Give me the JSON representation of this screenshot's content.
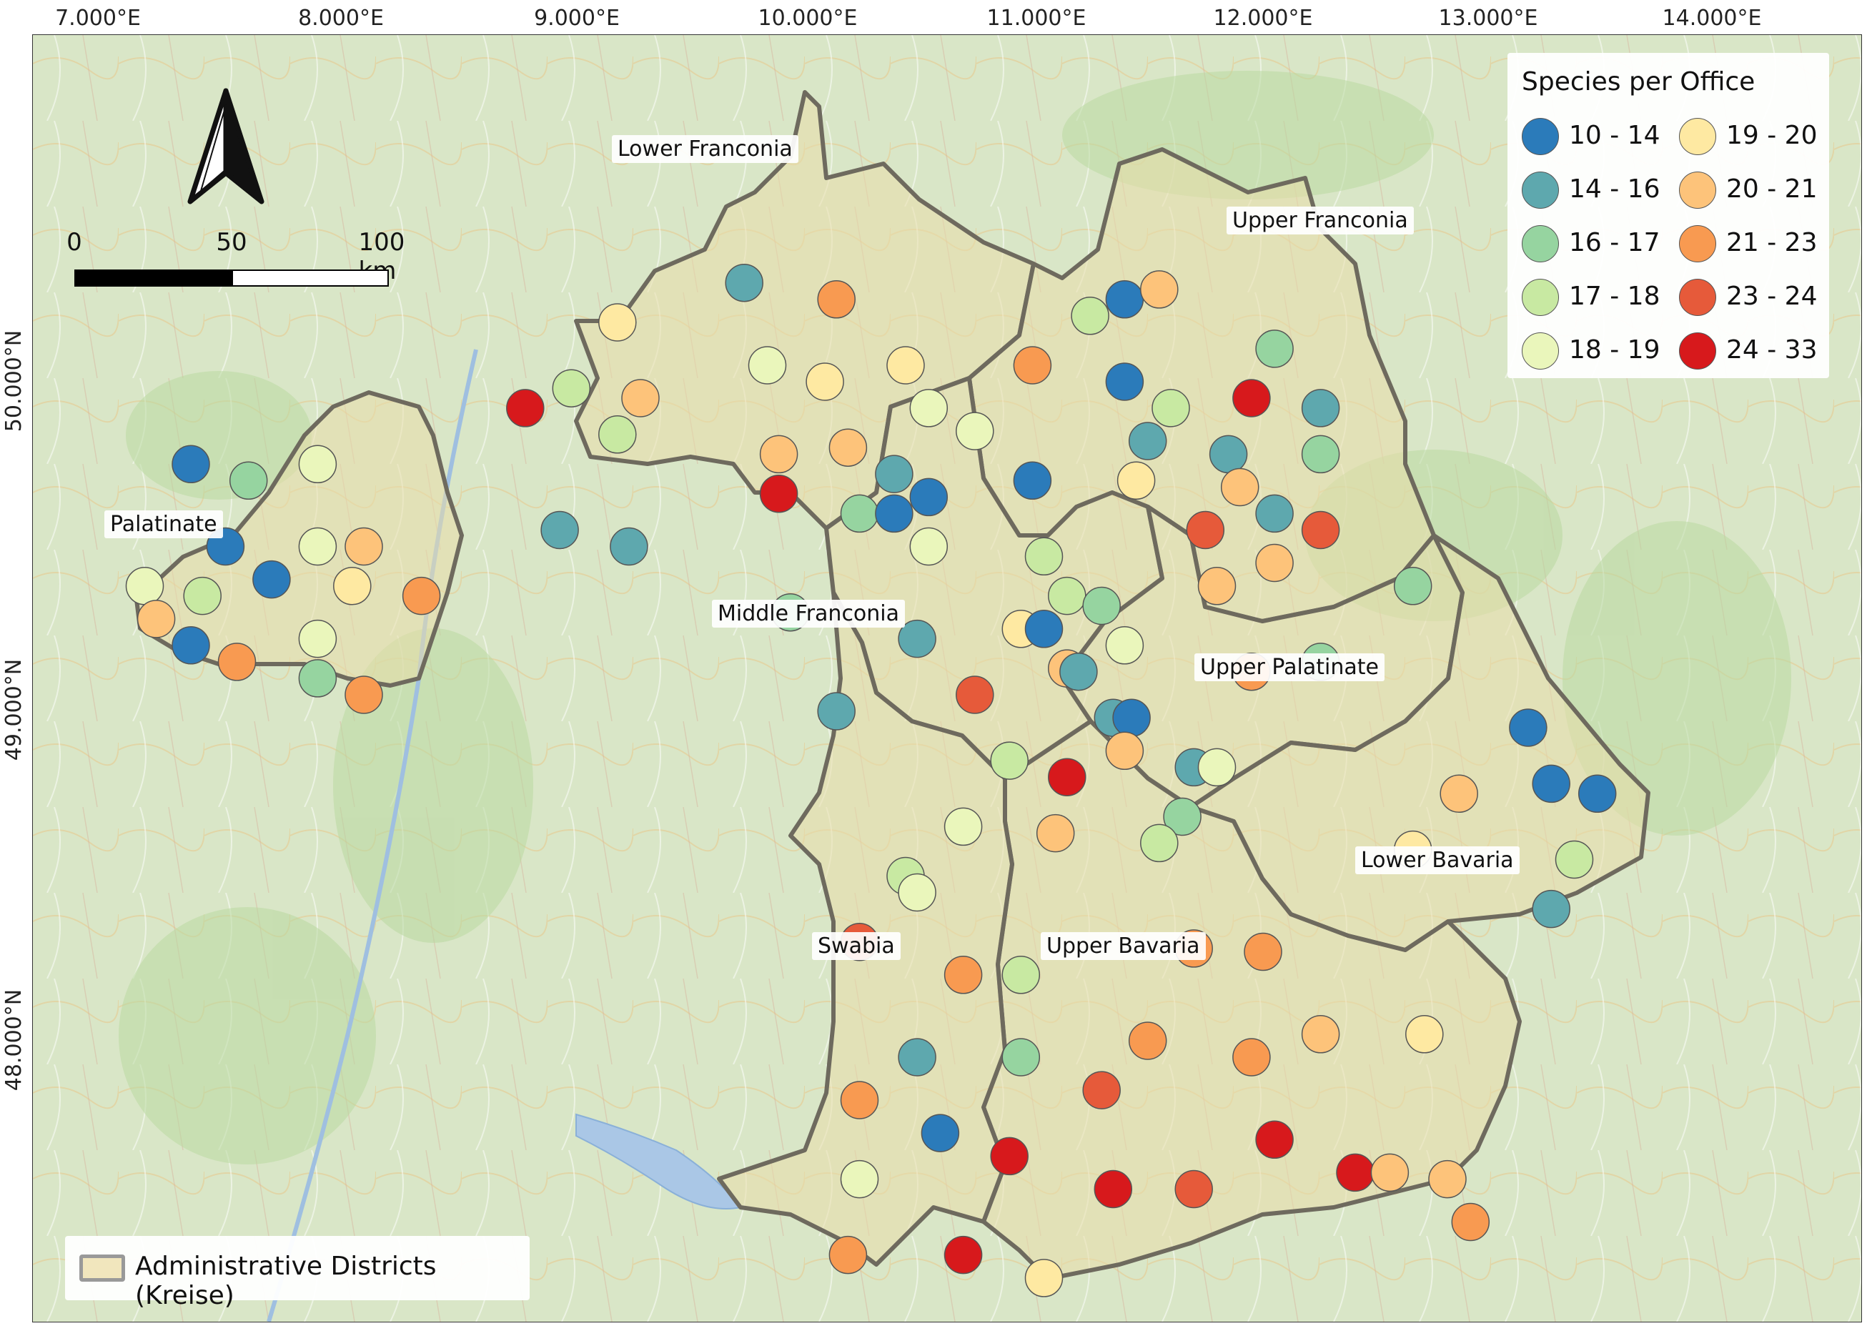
{
  "axes": {
    "longitude_labels": [
      "7.000°E",
      "8.000°E",
      "9.000°E",
      "10.000°E",
      "11.000°E",
      "12.000°E",
      "13.000°E",
      "14.000°E"
    ],
    "latitude_labels": [
      "50.000°N",
      "49.000°N",
      "48.000°N"
    ]
  },
  "regions": [
    {
      "name": "Lower Franconia"
    },
    {
      "name": "Upper Franconia"
    },
    {
      "name": "Palatinate"
    },
    {
      "name": "Middle Franconia"
    },
    {
      "name": "Upper Palatinate"
    },
    {
      "name": "Lower Bavaria"
    },
    {
      "name": "Swabia"
    },
    {
      "name": "Upper Bavaria"
    }
  ],
  "legend": {
    "title": "Species per Office",
    "classes": [
      {
        "label": "10 - 14",
        "color": "#2b7bba"
      },
      {
        "label": "14 - 16",
        "color": "#5ea8ae"
      },
      {
        "label": "16 - 17",
        "color": "#96d4a0"
      },
      {
        "label": "17 - 18",
        "color": "#c8e9a2"
      },
      {
        "label": "18 - 19",
        "color": "#eaf6bb"
      },
      {
        "label": "19 - 20",
        "color": "#fee9a2"
      },
      {
        "label": "20 - 21",
        "color": "#fdc37a"
      },
      {
        "label": "21 - 23",
        "color": "#f89a51"
      },
      {
        "label": "23 - 24",
        "color": "#e65a3a"
      },
      {
        "label": "24 - 33",
        "color": "#d7191c"
      }
    ]
  },
  "districts_legend": {
    "label": "Administrative Districts (Kreise)"
  },
  "scalebar": {
    "labels": [
      "0",
      "50",
      "100 km"
    ]
  },
  "offices": [
    {
      "lon": 9.8,
      "lat": 50.3,
      "cls": 1
    },
    {
      "lon": 10.2,
      "lat": 50.25,
      "cls": 7
    },
    {
      "lon": 9.25,
      "lat": 50.18,
      "cls": 5
    },
    {
      "lon": 9.9,
      "lat": 50.05,
      "cls": 4
    },
    {
      "lon": 10.5,
      "lat": 50.05,
      "cls": 5
    },
    {
      "lon": 10.15,
      "lat": 50.0,
      "cls": 5
    },
    {
      "lon": 9.05,
      "lat": 49.98,
      "cls": 3
    },
    {
      "lon": 9.35,
      "lat": 49.95,
      "cls": 6
    },
    {
      "lon": 8.85,
      "lat": 49.92,
      "cls": 9
    },
    {
      "lon": 10.6,
      "lat": 49.92,
      "cls": 4
    },
    {
      "lon": 9.25,
      "lat": 49.84,
      "cls": 3
    },
    {
      "lon": 10.25,
      "lat": 49.8,
      "cls": 6
    },
    {
      "lon": 10.8,
      "lat": 49.85,
      "cls": 4
    },
    {
      "lon": 9.95,
      "lat": 49.78,
      "cls": 6
    },
    {
      "lon": 10.45,
      "lat": 49.72,
      "cls": 1
    },
    {
      "lon": 9.95,
      "lat": 49.66,
      "cls": 9
    },
    {
      "lon": 10.6,
      "lat": 49.65,
      "cls": 0
    },
    {
      "lon": 10.3,
      "lat": 49.6,
      "cls": 2
    },
    {
      "lon": 10.45,
      "lat": 49.6,
      "cls": 0
    },
    {
      "lon": 9.0,
      "lat": 49.55,
      "cls": 1
    },
    {
      "lon": 10.6,
      "lat": 49.5,
      "cls": 4
    },
    {
      "lon": 11.45,
      "lat": 50.25,
      "cls": 0
    },
    {
      "lon": 11.6,
      "lat": 50.28,
      "cls": 6
    },
    {
      "lon": 11.3,
      "lat": 50.2,
      "cls": 3
    },
    {
      "lon": 12.1,
      "lat": 50.1,
      "cls": 2
    },
    {
      "lon": 11.05,
      "lat": 50.05,
      "cls": 7
    },
    {
      "lon": 11.45,
      "lat": 50.0,
      "cls": 0
    },
    {
      "lon": 12.0,
      "lat": 49.95,
      "cls": 9
    },
    {
      "lon": 11.65,
      "lat": 49.92,
      "cls": 3
    },
    {
      "lon": 12.3,
      "lat": 49.92,
      "cls": 1
    },
    {
      "lon": 11.55,
      "lat": 49.82,
      "cls": 1
    },
    {
      "lon": 11.9,
      "lat": 49.78,
      "cls": 1
    },
    {
      "lon": 12.3,
      "lat": 49.78,
      "cls": 2
    },
    {
      "lon": 11.05,
      "lat": 49.7,
      "cls": 0
    },
    {
      "lon": 11.5,
      "lat": 49.7,
      "cls": 5
    },
    {
      "lon": 11.95,
      "lat": 49.68,
      "cls": 6
    },
    {
      "lon": 12.1,
      "lat": 49.6,
      "cls": 1
    },
    {
      "lon": 11.8,
      "lat": 49.55,
      "cls": 8
    },
    {
      "lon": 12.3,
      "lat": 49.55,
      "cls": 8
    },
    {
      "lon": 11.1,
      "lat": 49.47,
      "cls": 3
    },
    {
      "lon": 12.1,
      "lat": 49.45,
      "cls": 6
    },
    {
      "lon": 11.85,
      "lat": 49.38,
      "cls": 6
    },
    {
      "lon": 12.7,
      "lat": 49.38,
      "cls": 2
    },
    {
      "lon": 9.3,
      "lat": 49.5,
      "cls": 1
    },
    {
      "lon": 11.2,
      "lat": 49.35,
      "cls": 3
    },
    {
      "lon": 11.35,
      "lat": 49.32,
      "cls": 2
    },
    {
      "lon": 10.0,
      "lat": 49.3,
      "cls": 2
    },
    {
      "lon": 11.0,
      "lat": 49.25,
      "cls": 5
    },
    {
      "lon": 11.1,
      "lat": 49.25,
      "cls": 0
    },
    {
      "lon": 10.55,
      "lat": 49.22,
      "cls": 1
    },
    {
      "lon": 11.45,
      "lat": 49.2,
      "cls": 4
    },
    {
      "lon": 12.3,
      "lat": 49.15,
      "cls": 2
    },
    {
      "lon": 11.2,
      "lat": 49.13,
      "cls": 6
    },
    {
      "lon": 11.25,
      "lat": 49.12,
      "cls": 1
    },
    {
      "lon": 12.0,
      "lat": 49.12,
      "cls": 7
    },
    {
      "lon": 10.8,
      "lat": 49.05,
      "cls": 8
    },
    {
      "lon": 10.2,
      "lat": 49.0,
      "cls": 1
    },
    {
      "lon": 11.4,
      "lat": 48.98,
      "cls": 1
    },
    {
      "lon": 11.48,
      "lat": 48.98,
      "cls": 0
    },
    {
      "lon": 13.2,
      "lat": 48.95,
      "cls": 0
    },
    {
      "lon": 10.95,
      "lat": 48.85,
      "cls": 3
    },
    {
      "lon": 11.45,
      "lat": 48.88,
      "cls": 6
    },
    {
      "lon": 11.75,
      "lat": 48.83,
      "cls": 1
    },
    {
      "lon": 11.85,
      "lat": 48.83,
      "cls": 4
    },
    {
      "lon": 11.2,
      "lat": 48.8,
      "cls": 9
    },
    {
      "lon": 13.3,
      "lat": 48.78,
      "cls": 0
    },
    {
      "lon": 13.5,
      "lat": 48.75,
      "cls": 0
    },
    {
      "lon": 12.9,
      "lat": 48.75,
      "cls": 6
    },
    {
      "lon": 11.7,
      "lat": 48.68,
      "cls": 2
    },
    {
      "lon": 10.75,
      "lat": 48.65,
      "cls": 4
    },
    {
      "lon": 11.15,
      "lat": 48.63,
      "cls": 6
    },
    {
      "lon": 11.6,
      "lat": 48.6,
      "cls": 3
    },
    {
      "lon": 12.7,
      "lat": 48.58,
      "cls": 5
    },
    {
      "lon": 13.4,
      "lat": 48.55,
      "cls": 3
    },
    {
      "lon": 10.5,
      "lat": 48.5,
      "cls": 3
    },
    {
      "lon": 10.55,
      "lat": 48.45,
      "cls": 4
    },
    {
      "lon": 13.3,
      "lat": 48.4,
      "cls": 1
    },
    {
      "lon": 10.3,
      "lat": 48.3,
      "cls": 8
    },
    {
      "lon": 11.75,
      "lat": 48.28,
      "cls": 7
    },
    {
      "lon": 12.05,
      "lat": 48.27,
      "cls": 7
    },
    {
      "lon": 10.75,
      "lat": 48.2,
      "cls": 7
    },
    {
      "lon": 11.0,
      "lat": 48.2,
      "cls": 3
    },
    {
      "lon": 12.3,
      "lat": 48.02,
      "cls": 6
    },
    {
      "lon": 12.75,
      "lat": 48.02,
      "cls": 5
    },
    {
      "lon": 11.55,
      "lat": 48.0,
      "cls": 7
    },
    {
      "lon": 12.0,
      "lat": 47.95,
      "cls": 7
    },
    {
      "lon": 10.55,
      "lat": 47.95,
      "cls": 1
    },
    {
      "lon": 11.0,
      "lat": 47.95,
      "cls": 2
    },
    {
      "lon": 11.35,
      "lat": 47.85,
      "cls": 8
    },
    {
      "lon": 10.3,
      "lat": 47.82,
      "cls": 7
    },
    {
      "lon": 10.65,
      "lat": 47.72,
      "cls": 0
    },
    {
      "lon": 12.1,
      "lat": 47.7,
      "cls": 9
    },
    {
      "lon": 10.95,
      "lat": 47.65,
      "cls": 9
    },
    {
      "lon": 12.45,
      "lat": 47.6,
      "cls": 9
    },
    {
      "lon": 12.6,
      "lat": 47.6,
      "cls": 6
    },
    {
      "lon": 12.85,
      "lat": 47.58,
      "cls": 6
    },
    {
      "lon": 10.3,
      "lat": 47.58,
      "cls": 4
    },
    {
      "lon": 11.4,
      "lat": 47.55,
      "cls": 9
    },
    {
      "lon": 11.75,
      "lat": 47.55,
      "cls": 8
    },
    {
      "lon": 12.95,
      "lat": 47.45,
      "cls": 7
    },
    {
      "lon": 10.25,
      "lat": 47.35,
      "cls": 7
    },
    {
      "lon": 10.75,
      "lat": 47.35,
      "cls": 9
    },
    {
      "lon": 11.1,
      "lat": 47.28,
      "cls": 5
    },
    {
      "lon": 7.4,
      "lat": 49.75,
      "cls": 0
    },
    {
      "lon": 7.65,
      "lat": 49.7,
      "cls": 2
    },
    {
      "lon": 7.95,
      "lat": 49.75,
      "cls": 4
    },
    {
      "lon": 7.55,
      "lat": 49.5,
      "cls": 0
    },
    {
      "lon": 7.75,
      "lat": 49.4,
      "cls": 0
    },
    {
      "lon": 7.95,
      "lat": 49.5,
      "cls": 4
    },
    {
      "lon": 8.15,
      "lat": 49.5,
      "cls": 6
    },
    {
      "lon": 7.2,
      "lat": 49.38,
      "cls": 4
    },
    {
      "lon": 7.45,
      "lat": 49.35,
      "cls": 3
    },
    {
      "lon": 8.1,
      "lat": 49.38,
      "cls": 5
    },
    {
      "lon": 8.4,
      "lat": 49.35,
      "cls": 7
    },
    {
      "lon": 7.25,
      "lat": 49.28,
      "cls": 6
    },
    {
      "lon": 7.4,
      "lat": 49.2,
      "cls": 0
    },
    {
      "lon": 7.95,
      "lat": 49.22,
      "cls": 4
    },
    {
      "lon": 7.6,
      "lat": 49.15,
      "cls": 7
    },
    {
      "lon": 7.95,
      "lat": 49.1,
      "cls": 2
    },
    {
      "lon": 8.15,
      "lat": 49.05,
      "cls": 7
    }
  ]
}
